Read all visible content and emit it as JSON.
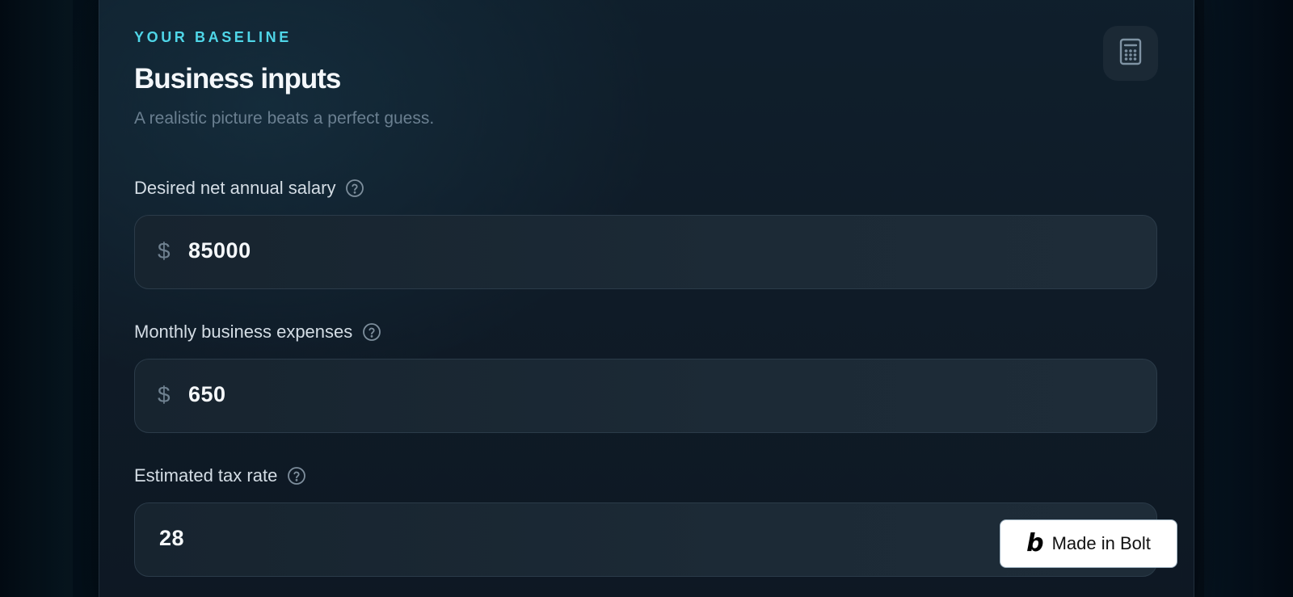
{
  "header": {
    "eyebrow": "YOUR BASELINE",
    "title": "Business inputs",
    "subtitle": "A realistic picture beats a perfect guess.",
    "icon": "calculator-icon"
  },
  "fields": [
    {
      "label": "Desired net annual salary",
      "prefix": "$",
      "value": "85000",
      "help_icon": "question-circle-icon"
    },
    {
      "label": "Monthly business expenses",
      "prefix": "$",
      "value": "650",
      "help_icon": "question-circle-icon"
    },
    {
      "label": "Estimated tax rate",
      "prefix": "",
      "value": "28",
      "help_icon": "question-circle-icon"
    }
  ],
  "badge": {
    "logo": "b",
    "label": "Made in Bolt"
  },
  "colors": {
    "accent": "#4fd6e8",
    "background": "#050d16",
    "card": "#0f1d29"
  }
}
